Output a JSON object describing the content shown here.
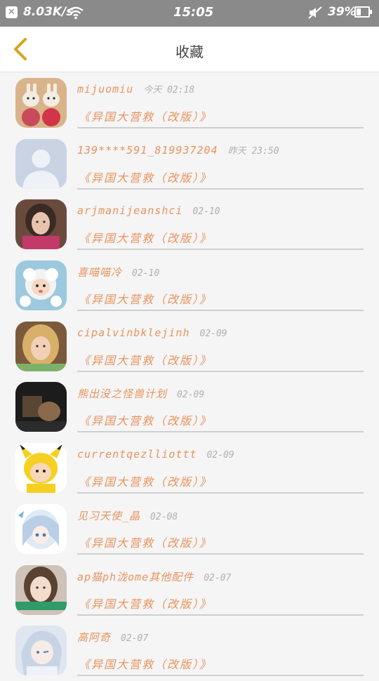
{
  "status_bar": {
    "close_glyph": "✕",
    "net_speed": "8.03K/s",
    "time": "15:05",
    "battery_text": "39%",
    "battery_level": 0.39
  },
  "header": {
    "title": "收藏",
    "back_icon": "chevron-left-icon"
  },
  "colors": {
    "accent": "#e8935f",
    "time_gray": "#b0b0b0",
    "status_bar_bg": "#8a8a8a",
    "page_bg": "#f5f5f5"
  },
  "items": [
    {
      "name": "mijuomiu",
      "time": "今天 02:18",
      "book": "《异国大营救（改版）》",
      "avatar": "plush-bunnies"
    },
    {
      "name": "139****591_819937204",
      "time": "昨天 23:50",
      "book": "《异国大营救（改版）》",
      "avatar": "default-silhouette"
    },
    {
      "name": "arjmanijeanshci",
      "time": "02-10",
      "book": "《异国大营救（改版）》",
      "avatar": "girl-portrait"
    },
    {
      "name": "喜喵喵冷",
      "time": "02-10",
      "book": "《异国大营救（改版）》",
      "avatar": "cartoon-sheep"
    },
    {
      "name": "cipalvinbklejinh",
      "time": "02-09",
      "book": "《异国大营救（改版）》",
      "avatar": "blonde-girl"
    },
    {
      "name": "熊出没之怪兽计划",
      "time": "02-09",
      "book": "《异国大营救（改版）》",
      "avatar": "dark-scene"
    },
    {
      "name": "currentqezlliottt",
      "time": "02-09",
      "book": "《异国大营救（改版）》",
      "avatar": "pikachu-kid"
    },
    {
      "name": "见习天使_晶",
      "time": "02-08",
      "book": "《异国大营救（改版）》",
      "avatar": "anime-girl"
    },
    {
      "name": "ap猫ph泷ome其他配件",
      "time": "02-07",
      "book": "《异国大营救（改版）》",
      "avatar": "selfie-girl"
    },
    {
      "name": "高阿奇",
      "time": "02-07",
      "book": "《异国大营救（改版）》",
      "avatar": "anime-boy"
    }
  ]
}
